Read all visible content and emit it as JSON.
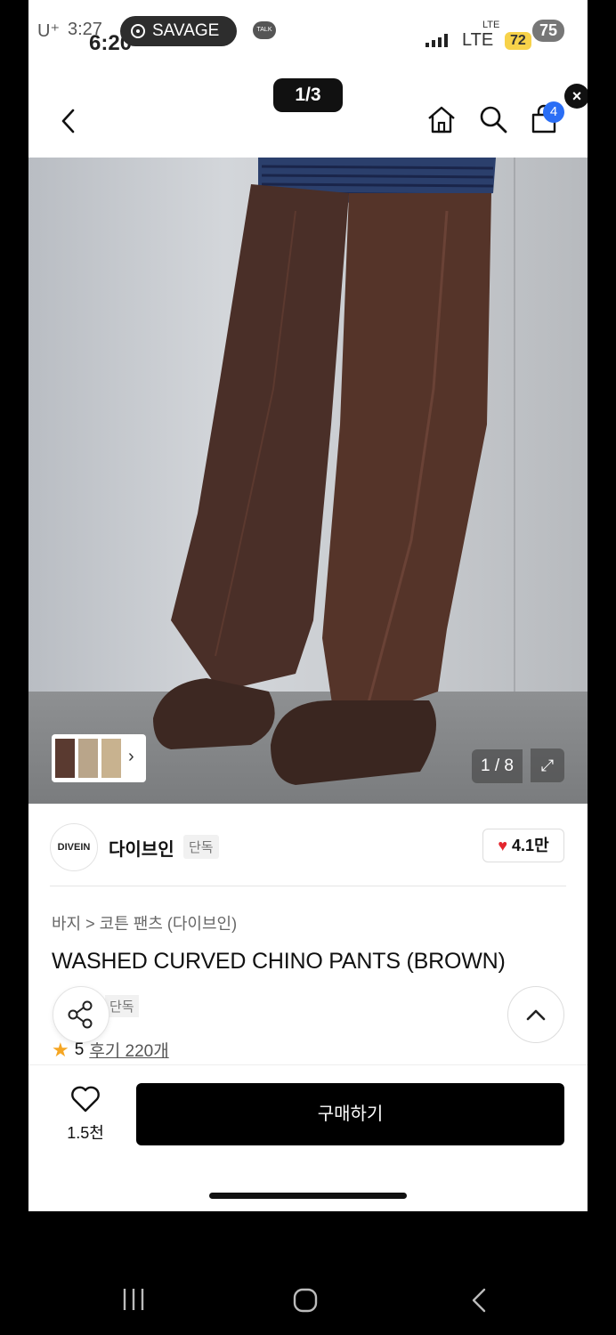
{
  "status_bar": {
    "carrier": "U⁺",
    "time_back": "3:27",
    "time_front": "6:20",
    "music_app": "SAVAGE",
    "talk_icon": "TALK",
    "network": "LTE",
    "network_small": "LTE",
    "battery_a": "72",
    "battery_b": "75"
  },
  "overlay": {
    "counter": "1/3",
    "close": "×"
  },
  "header": {
    "cart_count": "4"
  },
  "gallery": {
    "counter": "1 / 8"
  },
  "brand": {
    "logo_text": "DIVEIN",
    "name": "다이브인",
    "tag": "단독",
    "likes": "4.1만"
  },
  "product": {
    "breadcrumb": "바지 > 코튼 팬츠 (다이브인)",
    "title": "WASHED CURVED CHINO PANTS (BROWN)",
    "exclusive_tag": "단독",
    "rating": "5",
    "reviews": "후기 220개"
  },
  "bottom_bar": {
    "wish_count": "1.5천",
    "buy_label": "구매하기"
  },
  "colors": {
    "accent_blue": "#2a6ef5",
    "heart_red": "#e3262e",
    "star": "#f5a623",
    "pants_brown": "#4a2f28"
  }
}
